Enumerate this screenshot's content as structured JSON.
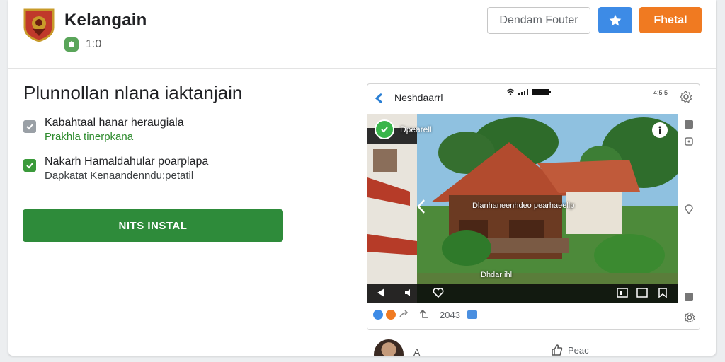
{
  "header": {
    "app_title": "Kelangain",
    "rating_value": "1:0",
    "btn_outline_label": "Dendam Fouter",
    "btn_install_label": "Fhetal"
  },
  "left": {
    "headline": "Plunnollan nlana iaktanjain",
    "features": [
      {
        "title": "Kabahtaal hanar heraugiala",
        "subtitle": "Prakhla tinerpkana",
        "checked_color": "grey"
      },
      {
        "title": "Nakarh Hamaldahular poarplapa",
        "subtitle": "Dapkatat Kenaandenndu:petatil",
        "checked_color": "green"
      }
    ],
    "install_label": "NITS INSTAL"
  },
  "panel": {
    "title": "Neshdaarrl",
    "time": "4:5 5",
    "badge_text": "Dpearell",
    "caption": "Dlanhaneenhdeo pearhaeellp",
    "caption2": "Dhdar ihl",
    "count": "2043"
  },
  "bottom": {
    "avatar_label": "A",
    "like_label": "Peac"
  },
  "colors": {
    "accent_orange": "#f07a21",
    "accent_blue": "#3d8be6",
    "install_green": "#2e8b3a"
  }
}
